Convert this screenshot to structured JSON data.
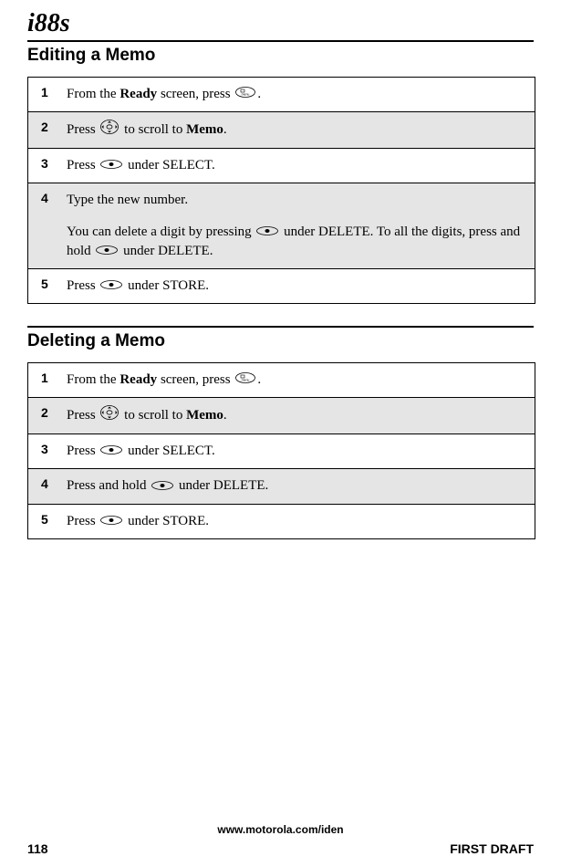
{
  "logo": "i88s",
  "sections": [
    {
      "title": "Editing a Memo",
      "steps": [
        {
          "num": "1",
          "shaded": false,
          "parts": [
            {
              "t": "text",
              "v": "From the "
            },
            {
              "t": "bold",
              "v": "Ready"
            },
            {
              "t": "text",
              "v": " screen, press "
            },
            {
              "t": "icon",
              "v": "menu"
            },
            {
              "t": "text",
              "v": "."
            }
          ]
        },
        {
          "num": "2",
          "shaded": true,
          "parts": [
            {
              "t": "text",
              "v": "Press "
            },
            {
              "t": "icon",
              "v": "nav"
            },
            {
              "t": "text",
              "v": " to scroll to "
            },
            {
              "t": "bold",
              "v": "Memo"
            },
            {
              "t": "text",
              "v": "."
            }
          ]
        },
        {
          "num": "3",
          "shaded": false,
          "parts": [
            {
              "t": "text",
              "v": "Press "
            },
            {
              "t": "icon",
              "v": "soft"
            },
            {
              "t": "text",
              "v": " under SELECT."
            }
          ]
        },
        {
          "num": "4",
          "shaded": true,
          "parts": [
            {
              "t": "text",
              "v": "Type the new number."
            }
          ],
          "extra": [
            {
              "t": "text",
              "v": "You can delete a digit by pressing "
            },
            {
              "t": "icon",
              "v": "soft"
            },
            {
              "t": "text",
              "v": " under DELETE. To all the digits, press and hold "
            },
            {
              "t": "icon",
              "v": "soft"
            },
            {
              "t": "text",
              "v": " under DELETE."
            }
          ]
        },
        {
          "num": "5",
          "shaded": false,
          "parts": [
            {
              "t": "text",
              "v": "Press "
            },
            {
              "t": "icon",
              "v": "soft"
            },
            {
              "t": "text",
              "v": " under STORE."
            }
          ]
        }
      ]
    },
    {
      "title": "Deleting a Memo",
      "steps": [
        {
          "num": "1",
          "shaded": false,
          "parts": [
            {
              "t": "text",
              "v": "From the "
            },
            {
              "t": "bold",
              "v": "Ready"
            },
            {
              "t": "text",
              "v": " screen, press "
            },
            {
              "t": "icon",
              "v": "menu"
            },
            {
              "t": "text",
              "v": "."
            }
          ]
        },
        {
          "num": "2",
          "shaded": true,
          "parts": [
            {
              "t": "text",
              "v": "Press "
            },
            {
              "t": "icon",
              "v": "nav"
            },
            {
              "t": "text",
              "v": " to scroll to "
            },
            {
              "t": "bold",
              "v": "Memo"
            },
            {
              "t": "text",
              "v": "."
            }
          ]
        },
        {
          "num": "3",
          "shaded": false,
          "parts": [
            {
              "t": "text",
              "v": "Press "
            },
            {
              "t": "icon",
              "v": "soft"
            },
            {
              "t": "text",
              "v": " under SELECT."
            }
          ]
        },
        {
          "num": "4",
          "shaded": true,
          "parts": [
            {
              "t": "text",
              "v": "Press and hold "
            },
            {
              "t": "icon",
              "v": "soft"
            },
            {
              "t": "text",
              "v": " under DELETE."
            }
          ]
        },
        {
          "num": "5",
          "shaded": false,
          "parts": [
            {
              "t": "text",
              "v": "Press "
            },
            {
              "t": "icon",
              "v": "soft"
            },
            {
              "t": "text",
              "v": " under STORE."
            }
          ]
        }
      ]
    }
  ],
  "footer": {
    "url": "www.motorola.com/iden",
    "page": "118",
    "status": "FIRST DRAFT"
  }
}
